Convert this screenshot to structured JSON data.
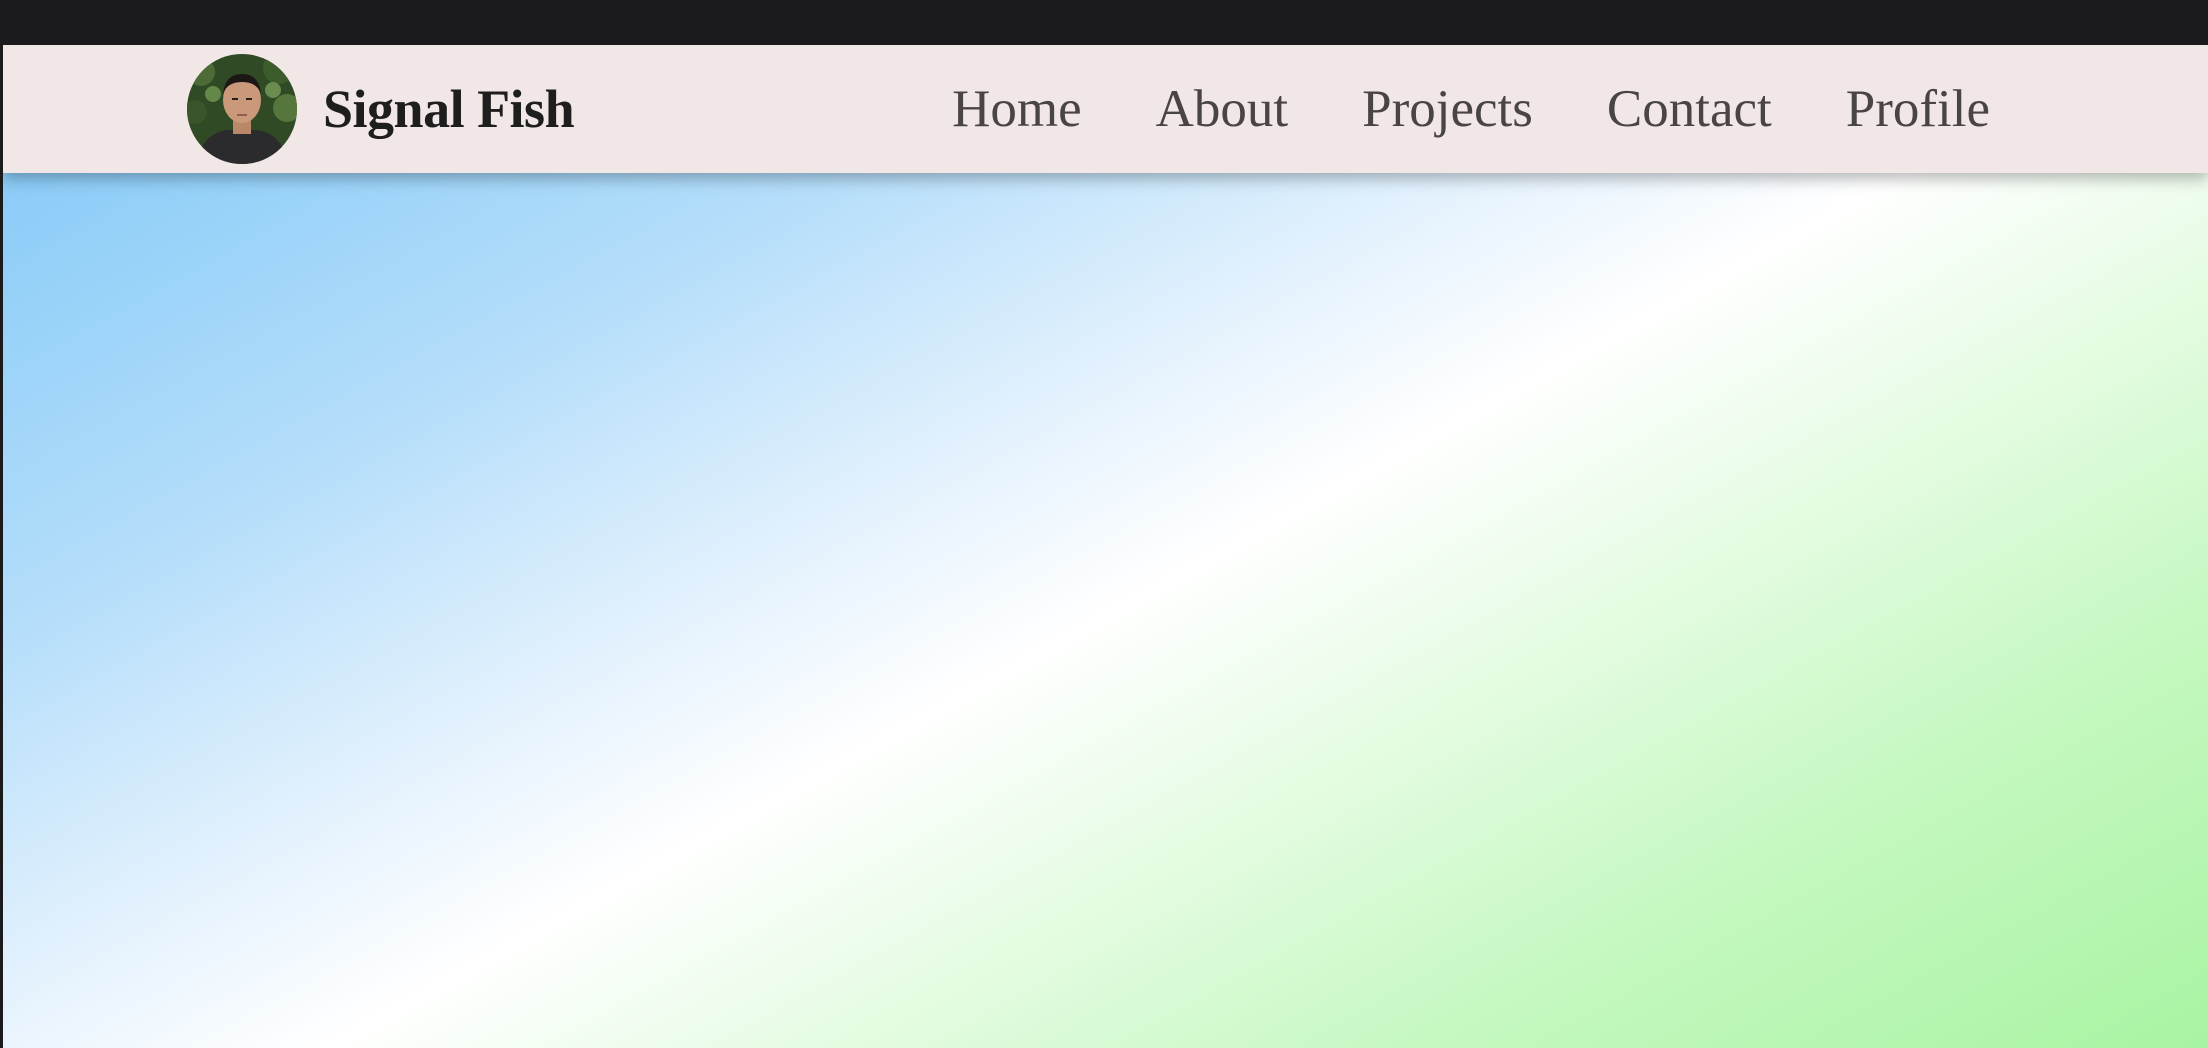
{
  "brand": {
    "name": "Signal Fish",
    "avatar_icon": "profile-photo"
  },
  "nav": {
    "links": [
      {
        "label": "Home"
      },
      {
        "label": "About"
      },
      {
        "label": "Projects"
      },
      {
        "label": "Contact"
      },
      {
        "label": "Profile"
      }
    ]
  },
  "colors": {
    "navbar_bg": "#f1e7e6",
    "nav_text": "#4a4545",
    "brand_text": "#1e1e1e",
    "gradient_start": "#7fc7f7",
    "gradient_mid": "#ffffff",
    "gradient_end": "#a8f4a2",
    "chrome": "#1b1b1d"
  }
}
